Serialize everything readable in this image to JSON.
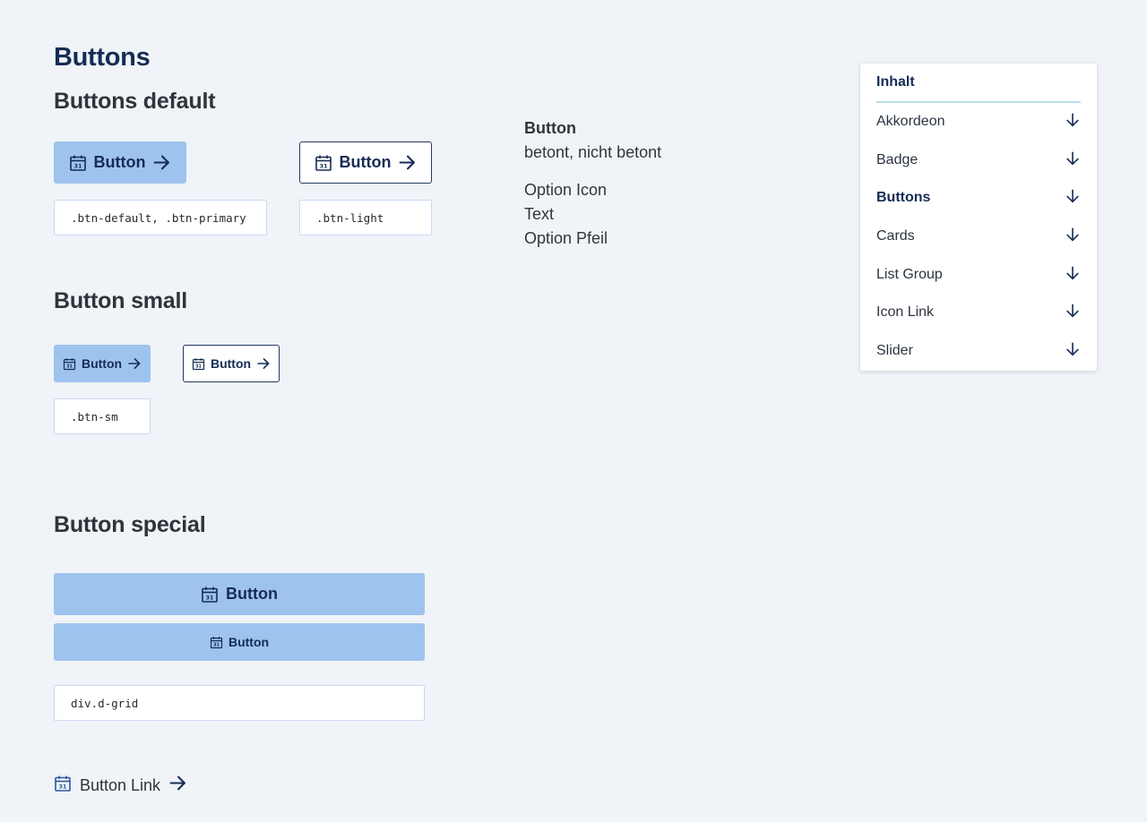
{
  "page_title": "Buttons",
  "sections": {
    "default_title": "Buttons default",
    "small_title": "Button small",
    "special_title": "Button special"
  },
  "buttons": {
    "label": "Button",
    "default_code": ".btn-default, .btn-primary",
    "light_code": ".btn-light",
    "small_code": ".btn-sm",
    "grid_code": "div.d-grid"
  },
  "info": {
    "title": "Button",
    "variant": "betont, nicht betont",
    "option_icon": "Option Icon",
    "text": "Text",
    "option_arrow": "Option Pfeil"
  },
  "link": {
    "label": "Button Link"
  },
  "toc": {
    "title": "Inhalt",
    "items": [
      {
        "label": "Akkordeon"
      },
      {
        "label": "Badge"
      },
      {
        "label": "Buttons"
      },
      {
        "label": "Cards"
      },
      {
        "label": "List Group"
      },
      {
        "label": "Icon Link"
      },
      {
        "label": "Slider"
      }
    ],
    "active": "Buttons"
  },
  "icons": {
    "calendar": "calendar-icon",
    "arrow_right": "arrow-right-icon",
    "arrow_down": "arrow-down-icon"
  },
  "colors": {
    "primary": "#9ec3ef",
    "dark_blue": "#152c55",
    "background": "#f0f3f7"
  }
}
